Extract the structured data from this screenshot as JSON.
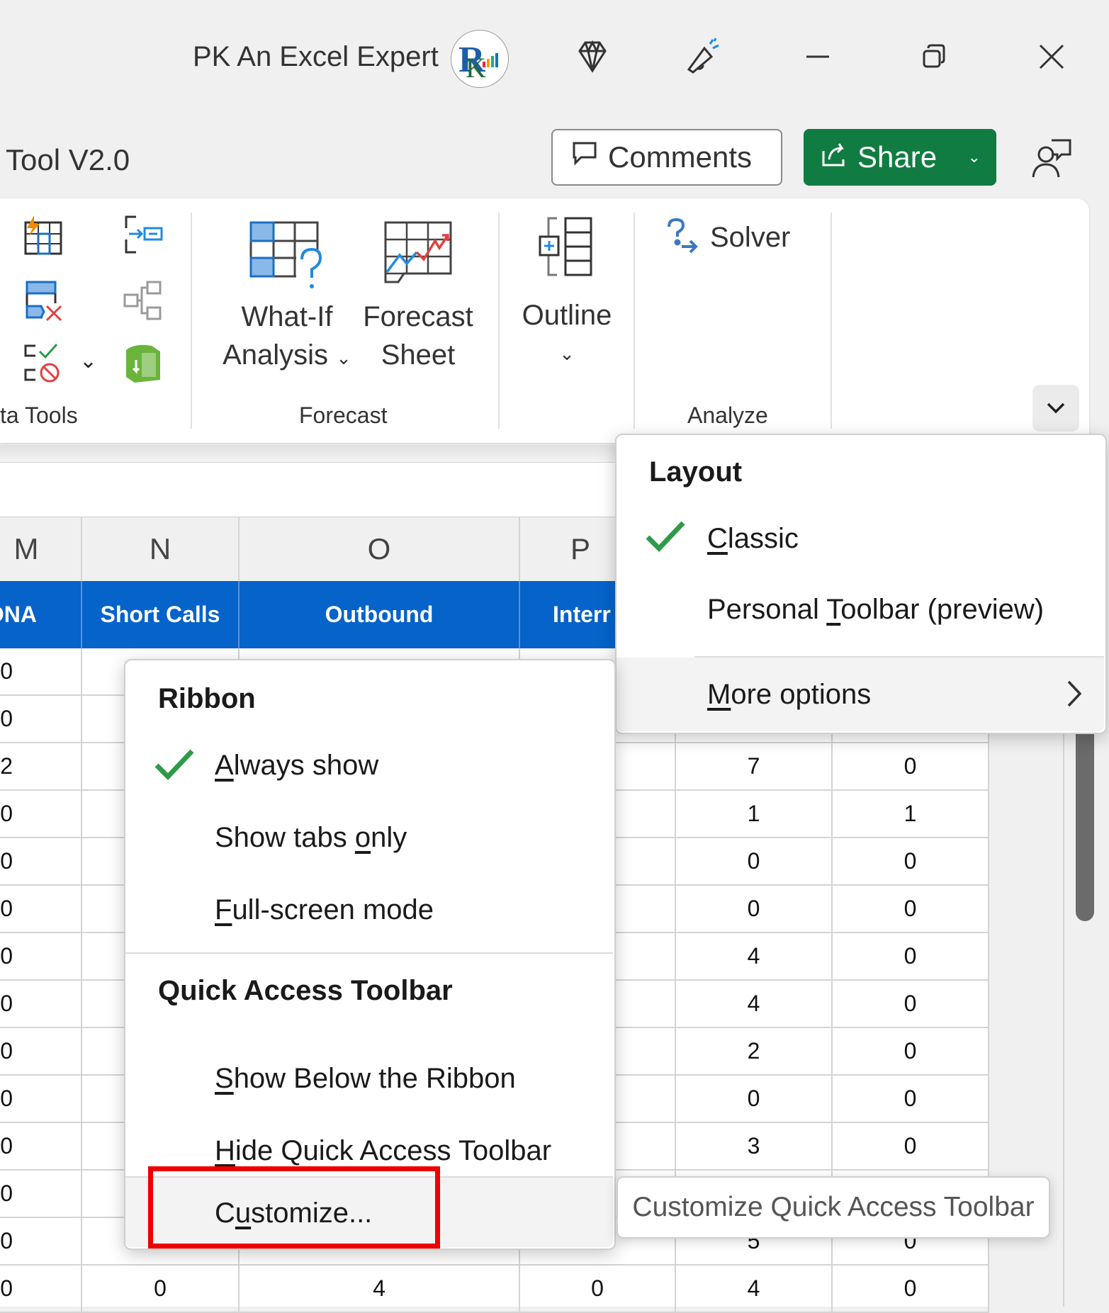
{
  "titlebar": {
    "user_name": "PK An Excel Expert",
    "icons": [
      "diamond-premium-icon",
      "megaphone-feedback-icon",
      "minimize-icon",
      "restore-icon",
      "close-icon"
    ]
  },
  "document": {
    "title_partial": "Tool V2.0"
  },
  "actions": {
    "comments_label": "Comments",
    "share_label": "Share"
  },
  "ribbon": {
    "groups": [
      {
        "label": "ta Tools",
        "full_label": "Data Tools"
      },
      {
        "label": "Forecast",
        "buttons": [
          {
            "line1": "What-If",
            "line2": "Analysis"
          },
          {
            "line1": "Forecast",
            "line2": "Sheet"
          }
        ]
      },
      {
        "label": "",
        "buttons": [
          {
            "line1": "Outline"
          }
        ]
      },
      {
        "label": "Analyze",
        "buttons": [
          {
            "line1": "Solver"
          }
        ]
      }
    ]
  },
  "sheet": {
    "columns": [
      "M",
      "N",
      "O",
      "P"
    ],
    "headers": [
      "DNA",
      "Short Calls",
      "Outbound",
      "Interr"
    ],
    "col_m_values": [
      "0",
      "0",
      "2",
      "0",
      "0",
      "0",
      "0",
      "0",
      "0",
      "0",
      "0",
      "0",
      "0",
      "0"
    ],
    "right_col1_values": [
      "7",
      "1",
      "0",
      "0",
      "4",
      "4",
      "2",
      "0",
      "3",
      "",
      "5",
      "4"
    ],
    "right_col2_values": [
      "0",
      "1",
      "0",
      "0",
      "0",
      "0",
      "0",
      "0",
      "0",
      "",
      "0",
      "0"
    ],
    "last_row": {
      "n": "0",
      "o": "4",
      "p": "0"
    }
  },
  "layout_menu": {
    "heading": "Layout",
    "items": [
      {
        "label": "Classic",
        "accel_index": 0,
        "checked": true
      },
      {
        "label": "Personal Toolbar (preview)",
        "accel_index": 9,
        "checked": false
      },
      {
        "label": "More options",
        "accel_index": 0,
        "checked": false,
        "submenu": true
      }
    ]
  },
  "ribbon_menu": {
    "ribbon_heading": "Ribbon",
    "ribbon_items": [
      {
        "label": "Always show",
        "checked": true
      },
      {
        "label": "Show tabs only",
        "checked": false
      },
      {
        "label": "Full-screen mode",
        "checked": false
      }
    ],
    "qat_heading": "Quick Access Toolbar",
    "qat_items": [
      {
        "label": "Show Below the Ribbon"
      },
      {
        "label": "Hide Quick Access Toolbar"
      },
      {
        "label": "Customize..."
      }
    ]
  },
  "tooltip": "Customize Quick Access Toolbar",
  "colors": {
    "excel_green": "#107c41",
    "header_blue": "#0563c9",
    "check_green": "#2e9b4a",
    "highlight_red": "#ee0000"
  }
}
